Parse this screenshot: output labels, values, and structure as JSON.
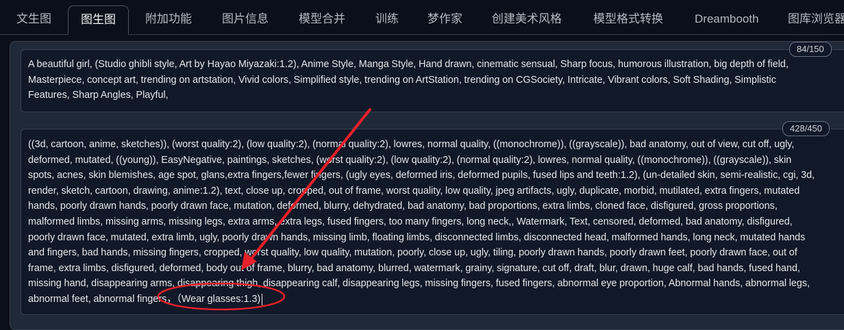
{
  "tabs": [
    {
      "label": "文生图"
    },
    {
      "label": "图生图"
    },
    {
      "label": "附加功能"
    },
    {
      "label": "图片信息"
    },
    {
      "label": "模型合并"
    },
    {
      "label": "训练"
    },
    {
      "label": "梦作家"
    },
    {
      "label": "创建美术风格"
    },
    {
      "label": "模型格式转换"
    },
    {
      "label": "Dreambooth"
    },
    {
      "label": "图库浏览器"
    }
  ],
  "selected_tab": "图生图",
  "positive_prompt": {
    "token_counter": "84/150",
    "lines": [
      "A beautiful girl, (Studio ghibli style, Art by Hayao Miyazaki:1.2), Anime Style, Manga Style, Hand drawn, cinematic sensual, Sharp focus, humorous illustration, big depth of field,",
      "Masterpiece, concept art, trending on artstation, Vivid colors, Simplified style, trending on ArtStation, trending on CGSociety, Intricate, Vibrant colors, Soft Shading, Simplistic",
      "Features, Sharp Angles, Playful,"
    ]
  },
  "negative_prompt": {
    "token_counter": "428/450",
    "lines": [
      "((3d, cartoon, anime, sketches)), (worst quality:2), (low quality:2), (normal quality:2), lowres, normal quality, ((monochrome)), ((grayscale)), bad anatomy, out of view, cut off, ugly,",
      "deformed, mutated, ((young)), EasyNegative, paintings, sketches, (worst quality:2), (low quality:2), (normal quality:2), lowres, normal quality, ((monochrome)), ((grayscale)), skin",
      "spots, acnes, skin blemishes, age spot, glans,extra fingers,fewer fingers, (ugly eyes, deformed iris, deformed pupils, fused lips and teeth:1.2), (un-detailed skin, semi-realistic, cgi, 3d,",
      "render, sketch, cartoon, drawing, anime:1.2), text, close up, cropped, out of frame, worst quality, low quality, jpeg artifacts, ugly, duplicate, morbid, mutilated, extra fingers, mutated",
      "hands, poorly drawn hands, poorly drawn face, mutation, deformed, blurry, dehydrated, bad anatomy, bad proportions, extra limbs, cloned face, disfigured, gross proportions,",
      "malformed limbs, missing arms, missing legs, extra arms, extra legs, fused fingers, too many fingers, long neck,, Watermark, Text, censored, deformed, bad anatomy, disfigured,",
      "poorly drawn face, mutated, extra limb, ugly, poorly drawn hands, missing limb, floating limbs, disconnected limbs, disconnected head, malformed hands, long neck, mutated hands",
      "and fingers, bad hands, missing fingers, cropped, worst quality, low quality, mutation, poorly, close up, ugly, tiling, poorly drawn hands, poorly drawn feet, poorly drawn face, out of",
      "frame, extra limbs, disfigured, deformed, body out of frame, blurry, bad anatomy, blurred, watermark, grainy, signature, cut off, draft, blur, drawn, huge calf, bad hands, fused hand,",
      "missing hand, disappearing arms, disappearing thigh, disappearing calf, disappearing legs, missing fingers, fused fingers, abnormal eye proportion, Abnormal hands, abnormal legs,",
      "abnormal feet, abnormal fingers，（Wear glasses:1.3)"
    ]
  },
  "colors": {
    "background": "#0b0f19",
    "panel": "#1f2937",
    "textbox": "#111827",
    "annotation": "#e8202a"
  }
}
